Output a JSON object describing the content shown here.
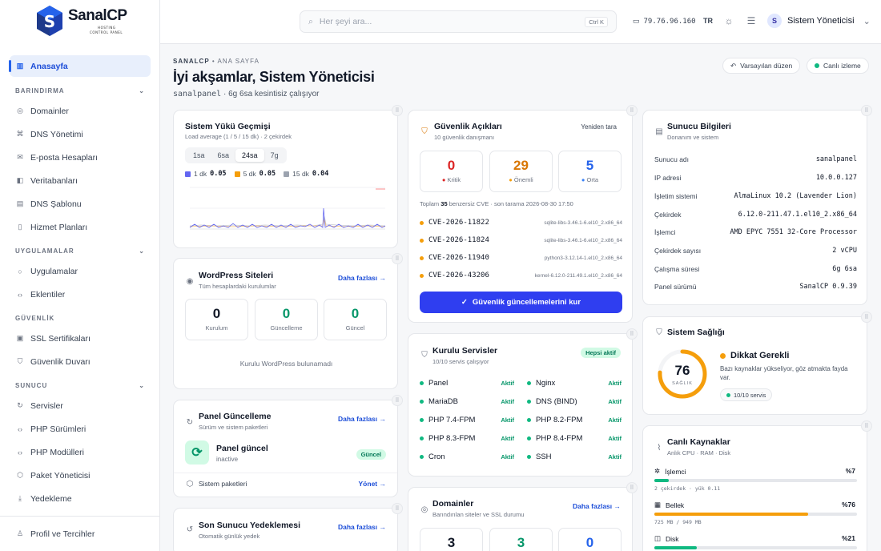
{
  "brand": {
    "name": "SanalCP",
    "tagline_line1": "HOSTING",
    "tagline_line2": "CONTROL PANEL"
  },
  "sidebar": {
    "home": "Anasayfa",
    "sections": [
      {
        "label": "BARINDIRMA",
        "items": [
          "Domainler",
          "DNS Yönetimi",
          "E-posta Hesapları",
          "Veritabanları",
          "DNS Şablonu",
          "Hizmet Planları"
        ]
      },
      {
        "label": "UYGULAMALAR",
        "items": [
          "Uygulamalar",
          "Eklentiler"
        ]
      },
      {
        "label": "GÜVENLİK",
        "items": [
          "SSL Sertifikaları",
          "Güvenlik Duvarı"
        ]
      },
      {
        "label": "SUNUCU",
        "items": [
          "Servisler",
          "PHP Sürümleri",
          "PHP Modülleri",
          "Paket Yöneticisi",
          "Yedekleme"
        ]
      }
    ],
    "profile": "Profil ve Tercihler"
  },
  "topbar": {
    "search_placeholder": "Her şeyi ara...",
    "shortcut": "Ctrl K",
    "ip": "79.76.96.160",
    "lang": "TR",
    "user_initial": "S",
    "user_name": "Sistem Yöneticisi"
  },
  "page": {
    "crumb_root": "SANALCP",
    "crumb_sep": "•",
    "crumb_current": "ANA SAYFA",
    "title": "İyi akşamlar, Sistem Yöneticisi",
    "host": "sanalpanel",
    "uptime": "6g 6sa kesintisiz çalışıyor",
    "btn_default": "Varsayılan düzen",
    "btn_live": "Canlı izleme"
  },
  "load": {
    "title": "Sistem Yükü Geçmişi",
    "subtitle": "Load average (1 / 5 / 15 dk) · 2 çekirdek",
    "tabs": [
      "1sa",
      "6sa",
      "24sa",
      "7g"
    ],
    "active_tab": "24sa",
    "legend": [
      {
        "label": "1 dk",
        "value": "0.05",
        "color": "#6366f1"
      },
      {
        "label": "5 dk",
        "value": "0.05",
        "color": "#f59e0b"
      },
      {
        "label": "15 dk",
        "value": "0.04",
        "color": "#9ca3af"
      }
    ]
  },
  "wordpress": {
    "title": "WordPress Siteleri",
    "subtitle": "Tüm hesaplardaki kurulumlar",
    "more": "Daha fazlası →",
    "stats": [
      {
        "value": "0",
        "label": "Kurulum"
      },
      {
        "value": "0",
        "label": "Güncelleme"
      },
      {
        "value": "0",
        "label": "Güncel"
      }
    ],
    "empty": "Kurulu WordPress bulunamadı"
  },
  "panel_update": {
    "title": "Panel Güncelleme",
    "subtitle": "Sürüm ve sistem paketleri",
    "more": "Daha fazlası →",
    "status": "Panel güncel",
    "status_sub": "inactive",
    "badge": "Güncel",
    "packages": "Sistem paketleri",
    "manage": "Yönet →"
  },
  "backup": {
    "title": "Son Sunucu Yedeklemesi",
    "subtitle": "Otomatik günlük yedek",
    "more": "Daha fazlası →"
  },
  "security": {
    "title": "Güvenlik Açıkları",
    "subtitle": "10 güvenlik danışmanı",
    "rescan": "Yeniden tara",
    "stats": [
      {
        "value": "0",
        "label": "Kritik",
        "color": "#dc2626"
      },
      {
        "value": "29",
        "label": "Önemli",
        "color": "#d97706"
      },
      {
        "value": "5",
        "label": "Orta",
        "color": "#2563eb"
      }
    ],
    "summary_pre": "Toplam",
    "summary_count": "35",
    "summary_post": "benzersiz CVE · son tarama 2026-08-30 17:50",
    "cves": [
      {
        "id": "CVE-2026-11822",
        "pkg": "sqlite-libs-3.46.1-6.el10_2.x86_64"
      },
      {
        "id": "CVE-2026-11824",
        "pkg": "sqlite-libs-3.46.1-6.el10_2.x86_64"
      },
      {
        "id": "CVE-2026-11940",
        "pkg": "python3-3.12.14-1.el10_2.x86_64"
      },
      {
        "id": "CVE-2026-43206",
        "pkg": "kernel-6.12.0-211.49.1.el10_2.x86_64"
      }
    ],
    "button": "Güvenlik güncellemelerini kur"
  },
  "services": {
    "title": "Kurulu Servisler",
    "subtitle": "10/10 servis çalışıyor",
    "badge": "Hepsi aktif",
    "items": [
      {
        "name": "Panel",
        "status": "Aktif"
      },
      {
        "name": "Nginx",
        "status": "Aktif"
      },
      {
        "name": "MariaDB",
        "status": "Aktif"
      },
      {
        "name": "DNS (BIND)",
        "status": "Aktif"
      },
      {
        "name": "PHP 7.4-FPM",
        "status": "Aktif"
      },
      {
        "name": "PHP 8.2-FPM",
        "status": "Aktif"
      },
      {
        "name": "PHP 8.3-FPM",
        "status": "Aktif"
      },
      {
        "name": "PHP 8.4-FPM",
        "status": "Aktif"
      },
      {
        "name": "Cron",
        "status": "Aktif"
      },
      {
        "name": "SSH",
        "status": "Aktif"
      }
    ]
  },
  "domains": {
    "title": "Domainler",
    "subtitle": "Barındırılan siteler ve SSL durumu",
    "more": "Daha fazlası →",
    "stats": [
      "3",
      "3",
      "0"
    ]
  },
  "server": {
    "title": "Sunucu Bilgileri",
    "subtitle": "Donanım ve sistem",
    "rows": [
      {
        "k": "Sunucu adı",
        "v": "sanalpanel"
      },
      {
        "k": "IP adresi",
        "v": "10.0.0.127"
      },
      {
        "k": "İşletim sistemi",
        "v": "AlmaLinux 10.2 (Lavender Lion)"
      },
      {
        "k": "Çekirdek",
        "v": "6.12.0-211.47.1.el10_2.x86_64"
      },
      {
        "k": "İşlemci",
        "v": "AMD EPYC 7551 32-Core Processor"
      },
      {
        "k": "Çekirdek sayısı",
        "v": "2 vCPU"
      },
      {
        "k": "Çalışma süresi",
        "v": "6g 6sa"
      },
      {
        "k": "Panel sürümü",
        "v": "SanalCP 0.9.39"
      }
    ]
  },
  "health": {
    "title": "Sistem Sağlığı",
    "score": 76,
    "score_label": "SAĞLIK",
    "status": "Dikkat Gerekli",
    "desc": "Bazı kaynaklar yükseliyor, göz atmakta fayda var.",
    "chip": "10/10 servis",
    "color": "#f59e0b"
  },
  "resources": {
    "title": "Canlı Kaynaklar",
    "subtitle": "Anlık CPU · RAM · Disk",
    "items": [
      {
        "label": "İşlemci",
        "pct": "%7",
        "sub": "2 çekirdek · yük 0.11",
        "value": 7,
        "color": "#10b981"
      },
      {
        "label": "Bellek",
        "pct": "%76",
        "sub": "725 MB / 949 MB",
        "value": 76,
        "color": "#f59e0b"
      },
      {
        "label": "Disk",
        "pct": "%21",
        "value": 21,
        "color": "#10b981"
      }
    ]
  }
}
